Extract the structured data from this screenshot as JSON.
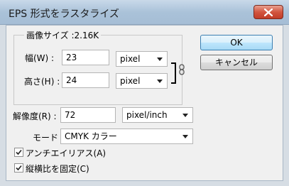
{
  "window": {
    "title": "EPS 形式をラスタライズ"
  },
  "image_size": {
    "label": "画像サイズ :2.16K"
  },
  "width": {
    "label": "幅(W) :",
    "value": "23",
    "unit": "pixel"
  },
  "height": {
    "label": "高さ(H) :",
    "value": "24",
    "unit": "pixel"
  },
  "resolution": {
    "label": "解像度(R) :",
    "value": "72",
    "unit": "pixel/inch"
  },
  "mode": {
    "label": "モード :",
    "value": "CMYK カラー"
  },
  "options": {
    "antialias": {
      "label": "アンチエイリアス(A)",
      "checked": true
    },
    "constrain": {
      "label": "縦横比を固定(C)",
      "checked": true
    }
  },
  "buttons": {
    "ok": "OK",
    "cancel": "キャンセル"
  }
}
